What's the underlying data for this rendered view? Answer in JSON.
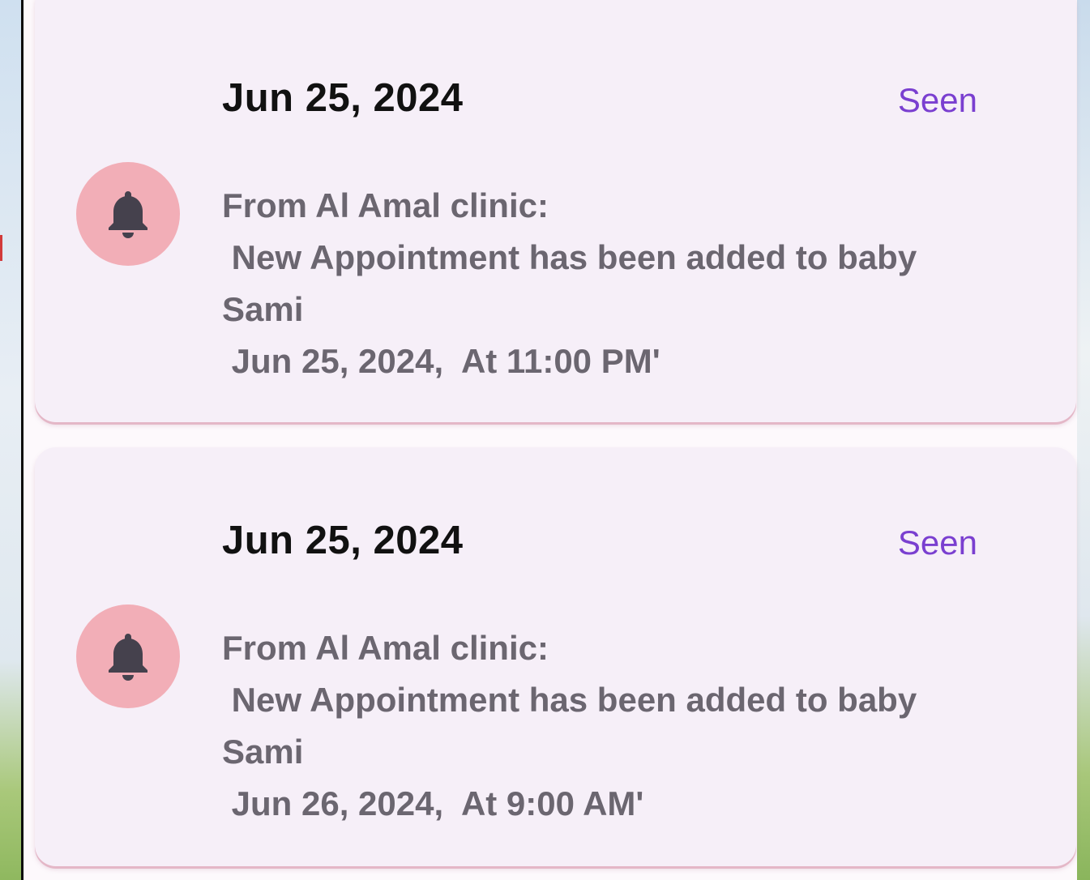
{
  "notifications": [
    {
      "date": "Jun 25, 2024",
      "status": "Seen",
      "icon": "bell-icon",
      "message": {
        "line1": "From Al Amal clinic:",
        "line2": " New Appointment has been added to baby",
        "line3": "Sami",
        "line4": " Jun 25, 2024,  At 11:00 PM'"
      }
    },
    {
      "date": "Jun 25, 2024",
      "status": "Seen",
      "icon": "bell-icon",
      "message": {
        "line1": "From Al Amal clinic:",
        "line2": " New Appointment has been added to baby",
        "line3": "Sami",
        "line4": " Jun 26, 2024,  At 9:00 AM'"
      }
    }
  ],
  "colors": {
    "card_background": "#f6eff8",
    "status_accent": "#7a3fd0",
    "icon_circle": "#f2aeb7",
    "icon_glyph": "#45414d",
    "message_text": "#6b6670"
  }
}
